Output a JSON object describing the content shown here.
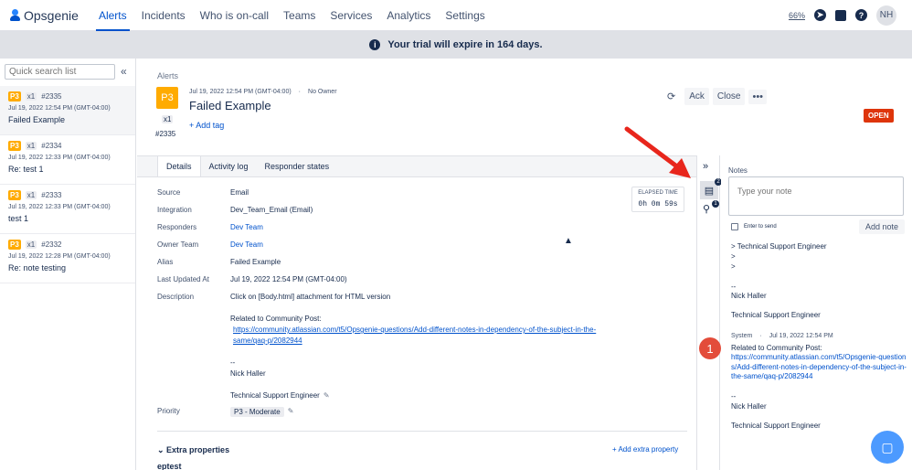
{
  "nav": {
    "brand": "Opsgenie",
    "items": [
      "Alerts",
      "Incidents",
      "Who is on-call",
      "Teams",
      "Services",
      "Analytics",
      "Settings"
    ],
    "active": "Alerts",
    "zoom": "66%",
    "avatar": "NH",
    "help": "?"
  },
  "banner": {
    "text": "Your trial will expire in 164 days."
  },
  "sidebar": {
    "search_placeholder": "Quick search list",
    "alerts": [
      {
        "priority": "P3",
        "count": "x1",
        "id": "#2335",
        "date": "Jul 19, 2022 12:54 PM (GMT-04:00)",
        "title": "Failed Example"
      },
      {
        "priority": "P3",
        "count": "x1",
        "id": "#2334",
        "date": "Jul 19, 2022 12:33 PM (GMT-04:00)",
        "title": "Re: test 1"
      },
      {
        "priority": "P3",
        "count": "x1",
        "id": "#2333",
        "date": "Jul 19, 2022 12:33 PM (GMT-04:00)",
        "title": "test 1"
      },
      {
        "priority": "P3",
        "count": "x1",
        "id": "#2332",
        "date": "Jul 19, 2022 12:28 PM (GMT-04:00)",
        "title": "Re: note testing"
      }
    ]
  },
  "alert": {
    "breadcrumb": "Alerts",
    "priority": "P3",
    "count": "x1",
    "id": "#2335",
    "date": "Jul 19, 2022 12:54 PM (GMT-04:00)",
    "owner": "No Owner",
    "title": "Failed Example",
    "add_tag": "+ Add tag",
    "ack": "Ack",
    "close": "Close",
    "status": "OPEN",
    "tabs": [
      "Details",
      "Activity log",
      "Responder states"
    ],
    "elapsed_label": "ELAPSED TIME",
    "elapsed": "0h 0m  59s",
    "fields": {
      "source_label": "Source",
      "source": "Email",
      "integration_label": "Integration",
      "integration": "Dev_Team_Email (Email)",
      "responders_label": "Responders",
      "responders": "Dev Team",
      "owner_team_label": "Owner Team",
      "owner_team": "Dev Team",
      "alias_label": "Alias",
      "alias": "Failed Example",
      "last_updated_label": "Last Updated At",
      "last_updated": "Jul 19, 2022 12:54 PM (GMT-04:00)",
      "description_label": "Description",
      "desc_line1": "Click on [Body.html] attachment for HTML version",
      "desc_line2": "Related to Community Post:",
      "desc_link1": "https://community.atlassian.com/t5/Opsgenie-questions/Add-different-notes-in-dependency-of-the-subject-in-the-",
      "desc_link2": "same/qaq-p/2082944",
      "desc_sig1": "--",
      "desc_sig2": "Nick Haller",
      "desc_sig3": "Technical Support Engineer",
      "priority_label": "Priority",
      "priority": "P3 - Moderate"
    },
    "extra_properties": "Extra properties",
    "add_extra": "+ Add extra property",
    "eptest": "eptest"
  },
  "strip": {
    "notes_badge": "2",
    "attach_badge": "1"
  },
  "notes": {
    "title": "Notes",
    "placeholder": "Type your note",
    "enter_to_send": "Enter to send",
    "add_note": "Add note",
    "note1": [
      ">  Technical Support Engineer",
      ">",
      ">",
      "",
      "--",
      "Nick Haller",
      "",
      "Technical Support Engineer"
    ],
    "note2_author": "System",
    "note2_date": "Jul 19, 2022 12:54 PM",
    "note2_text": "Related to Community Post:",
    "note2_link": "https://community.atlassian.com/t5/Opsgenie-questions/Add-different-notes-in-dependency-of-the-subject-in-the-same/qaq-p/2082944",
    "note2_sig1": "--",
    "note2_sig2": "Nick Haller",
    "note2_sig3": "Technical Support Engineer"
  },
  "annotation": {
    "marker": "1",
    "arrow_color": "#e8261c"
  }
}
